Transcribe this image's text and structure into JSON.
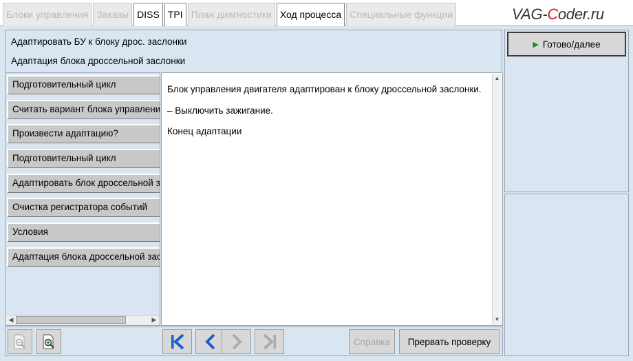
{
  "tabs": [
    {
      "label": "Блоки управления",
      "active": false
    },
    {
      "label": "Заказы",
      "active": false
    },
    {
      "label": "DISS",
      "active": true
    },
    {
      "label": "TPI",
      "active": true
    },
    {
      "label": "План диагностики",
      "active": false
    },
    {
      "label": "Ход процесса",
      "active": true
    },
    {
      "label": "Специальные функции",
      "active": false
    }
  ],
  "watermark": {
    "part1": "VAG-",
    "part2": "C",
    "part3": "oder.ru"
  },
  "header": {
    "line1": "Адаптировать БУ к блоку дрос. заслонки",
    "line2": "Адаптация блока дроссельной заслонки"
  },
  "steps": [
    "Подготовительный цикл",
    "Считать вариант блока управления",
    "Произвести адаптацию?",
    "Подготовительный цикл",
    "Адаптировать блок дроссельной заслонки",
    "Очистка регистратора событий",
    "Условия",
    "Адаптация блока дроссельной заслонки"
  ],
  "message": {
    "line1": "Блок управления двигателя адаптирован к блоку дроссельной заслонки.",
    "line2": "– Выключить зажигание.",
    "line3": "Конец адаптации"
  },
  "buttons": {
    "next": "Готово/далее",
    "help": "Справка",
    "abort": "Прервать проверку"
  },
  "colors": {
    "background": "#dae5f2",
    "accent_icon": "#1e5fd0",
    "next_triangle": "#1a8c1a"
  }
}
